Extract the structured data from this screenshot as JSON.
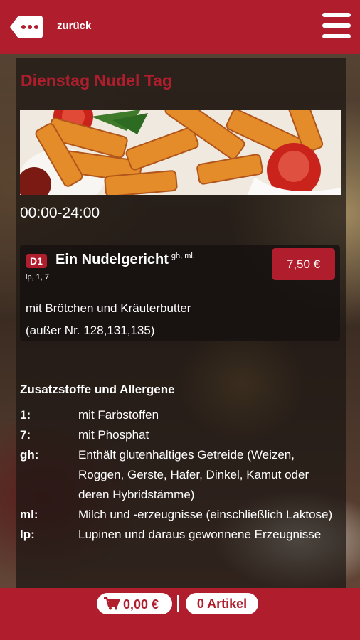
{
  "topbar": {
    "back_label": "zurück"
  },
  "page": {
    "title": "Dienstag Nudel Tag",
    "hours": "00:00-24:00"
  },
  "dish": {
    "badge": "D1",
    "name": "Ein Nudelgericht",
    "allergens_inline": "gh, ml,",
    "allergens_line2": "lp, 1, 7",
    "price": "7,50 €",
    "description_line1": "mit Brötchen und Kräuterbutter",
    "description_line2": "(außer Nr. 128,131,135)"
  },
  "allergens": {
    "title": "Zusatzstoffe und Allergene",
    "items": [
      {
        "key": "1:",
        "value": "mit Farbstoffen"
      },
      {
        "key": "7:",
        "value": "mit Phosphat"
      },
      {
        "key": "gh:",
        "value": "Enthält glutenhaltiges Getreide (Weizen, Roggen, Gerste, Hafer, Dinkel, Kamut oder deren Hybridstämme)"
      },
      {
        "key": "ml:",
        "value": "Milch und -erzeugnisse (einschließlich Laktose)"
      },
      {
        "key": "lp:",
        "value": "Lupinen und daraus gewonnene Erzeugnisse"
      }
    ]
  },
  "cart": {
    "total": "0,00 €",
    "items_label": "0 Artikel"
  },
  "colors": {
    "brand": "#b01e2e"
  },
  "icons": {
    "back": "speech-bubble-back-icon",
    "menu": "hamburger-menu-icon",
    "cart": "shopping-cart-icon"
  }
}
